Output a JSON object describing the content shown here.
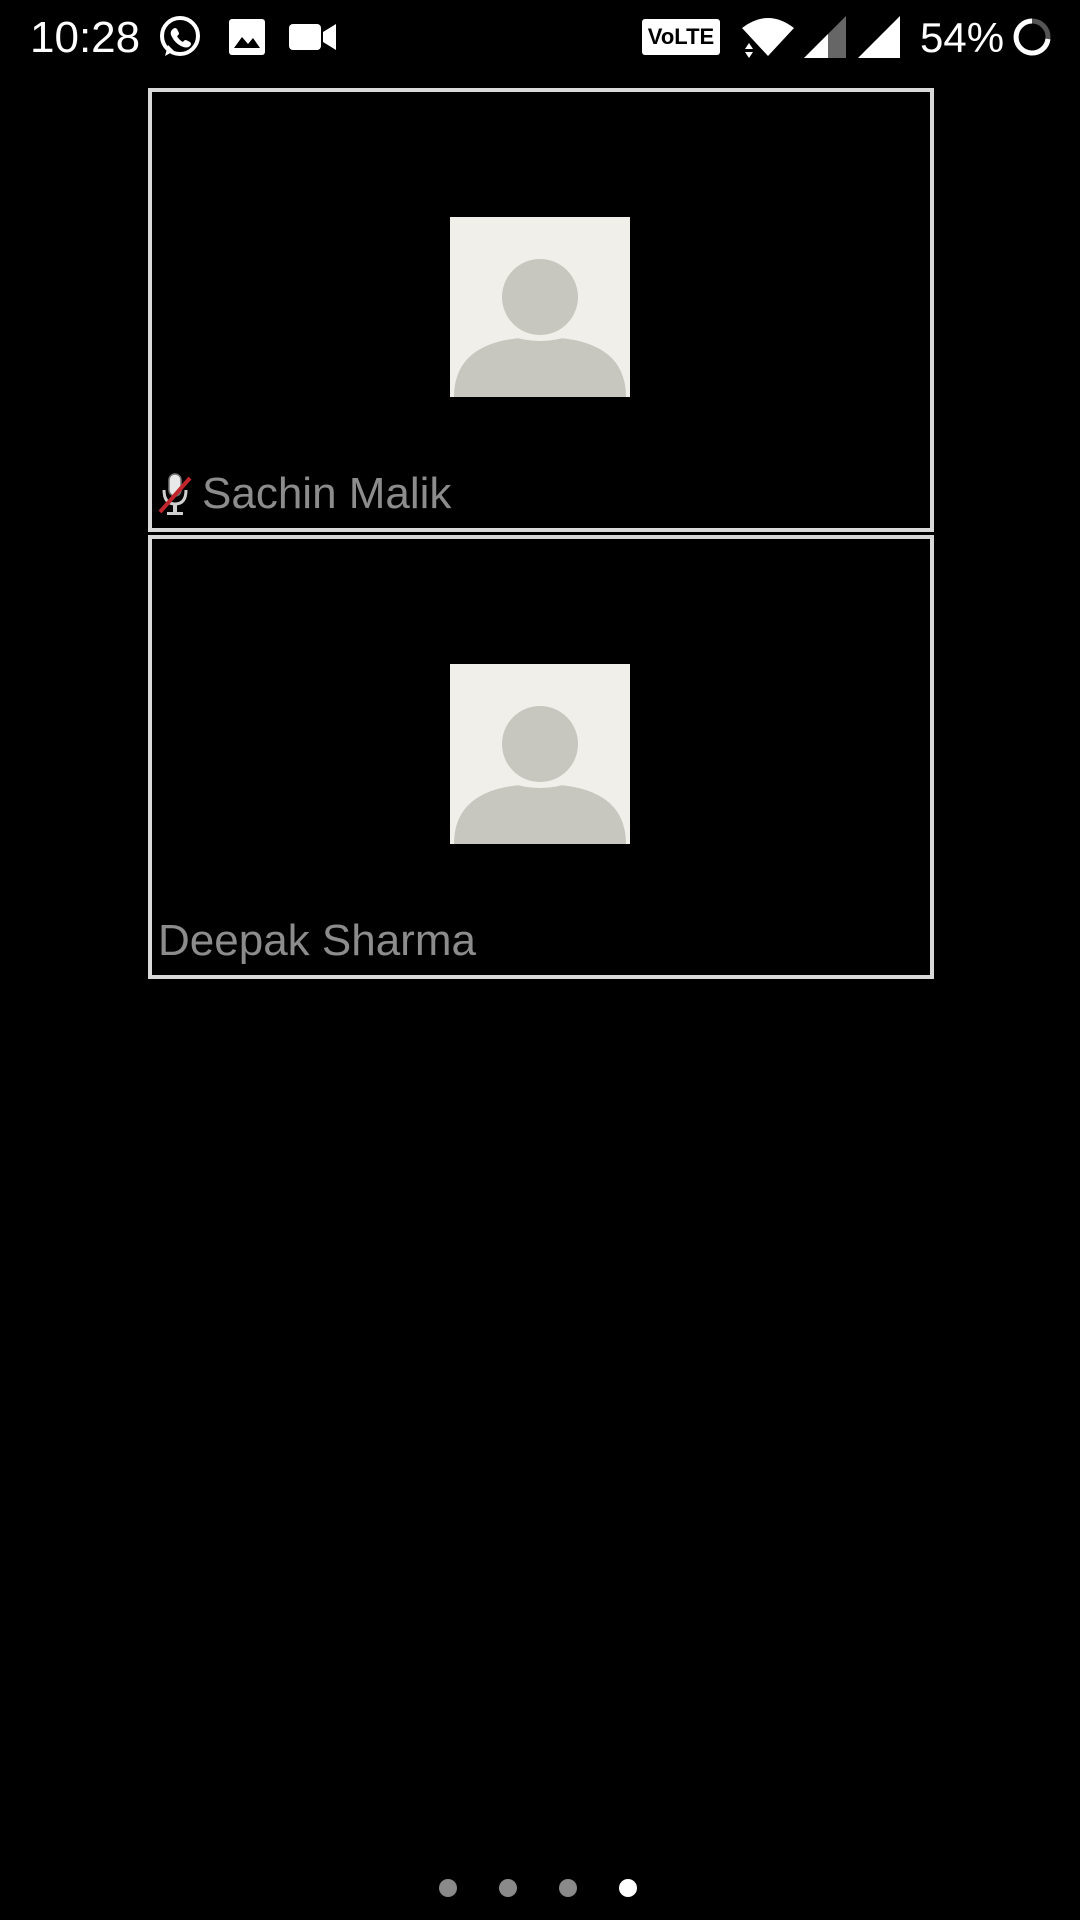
{
  "status_bar": {
    "time": "10:28",
    "notification_icons": [
      "whatsapp-icon",
      "image-icon",
      "video-camera-icon"
    ],
    "volte_label": "VoLTE",
    "battery_percent": "54%",
    "icons": [
      "wifi-icon",
      "signal-icon",
      "signal-full-icon",
      "battery-ring-icon"
    ]
  },
  "participants": [
    {
      "name": "Sachin Malik",
      "muted": true
    },
    {
      "name": "Deepak Sharma",
      "muted": false
    }
  ],
  "page_indicator": {
    "count": 4,
    "active_index": 3
  },
  "colors": {
    "background": "#000000",
    "tile_border": "#d9d9d9",
    "avatar_bg": "#f0efea",
    "avatar_silhouette": "#c8c7bf",
    "name_text": "#8c8c8c",
    "dot_inactive": "#8a8a8a",
    "dot_active": "#ffffff"
  }
}
